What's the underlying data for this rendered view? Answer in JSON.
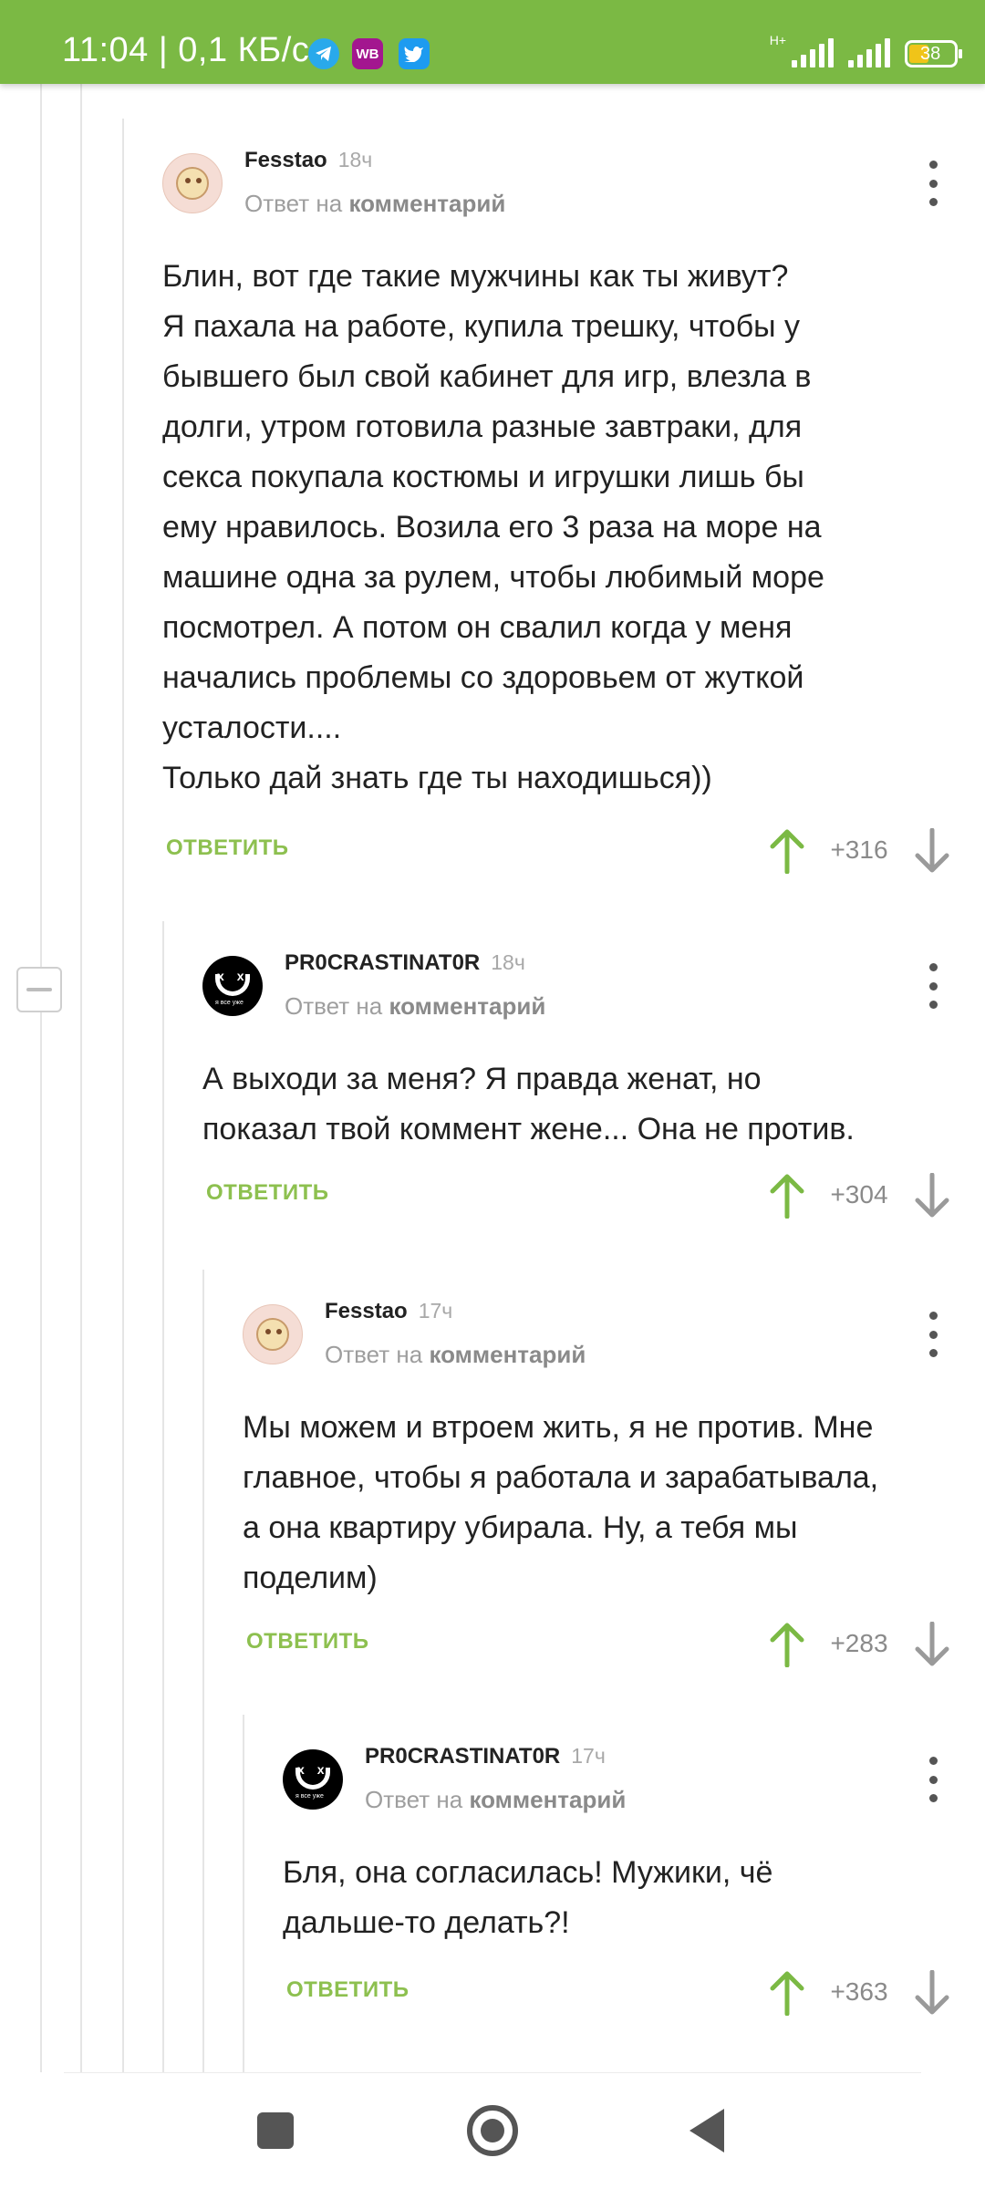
{
  "status_bar": {
    "time": "11:04 | 0,1 КБ/с",
    "wb_label": "WB",
    "network_type": "H+",
    "battery": "38"
  },
  "comments": [
    {
      "author": "Fesstao",
      "time": "18ч",
      "reply_prefix": "Ответ на",
      "reply_target": "комментарий",
      "text": "Блин, вот где такие мужчины как ты живут?\nЯ пахала на работе, купила трешку, чтобы у\nбывшего был свой кабинет для игр, влезла в\nдолги, утром готовила разные завтраки, для\nсекса покупала костюмы и игрушки лишь бы\nему нравилось. Возила его 3 раза на море на\nмашине одна за рулем, чтобы любимый море\nпосмотрел. А потом  он свалил когда у меня\nначались проблемы со здоровьем от жуткой\nусталости....\nТолько дай знать где ты находишься))",
      "reply_label": "ОТВЕТИТЬ",
      "rating": "+316"
    },
    {
      "author": "PR0CRASTINAT0R",
      "time": "18ч",
      "reply_prefix": "Ответ на",
      "reply_target": "комментарий",
      "text": "А выходи за меня? Я правда женат, но\nпоказал твой коммент жене... Она не против.",
      "reply_label": "ОТВЕТИТЬ",
      "rating": "+304"
    },
    {
      "author": "Fesstao",
      "time": "17ч",
      "reply_prefix": "Ответ на",
      "reply_target": "комментарий",
      "text": "Мы можем и втроем жить, я не против. Мне\nглавное, чтобы я работала и зарабатывала,\nа она квартиру убирала. Ну, а тебя мы\nподелим)",
      "reply_label": "ОТВЕТИТЬ",
      "rating": "+283"
    },
    {
      "author": "PR0CRASTINAT0R",
      "time": "17ч",
      "reply_prefix": "Ответ на",
      "reply_target": "комментарий",
      "text": "Бля, она согласилась! Мужики, чё\nдальше-то делать?!",
      "reply_label": "ОТВЕТИТЬ",
      "rating": "+363"
    }
  ],
  "colors": {
    "accent": "#7bb944",
    "reply_link": "#8dc04f",
    "vote_up": "#7bb944",
    "vote_down": "#9a9a9a"
  },
  "icons": [
    "telegram-icon",
    "wb-icon",
    "twitter-icon",
    "signal-icon",
    "battery-icon",
    "more-icon",
    "arrow-up-icon",
    "arrow-down-icon",
    "collapse-icon",
    "nav-square-icon",
    "nav-home-icon",
    "nav-back-icon"
  ]
}
